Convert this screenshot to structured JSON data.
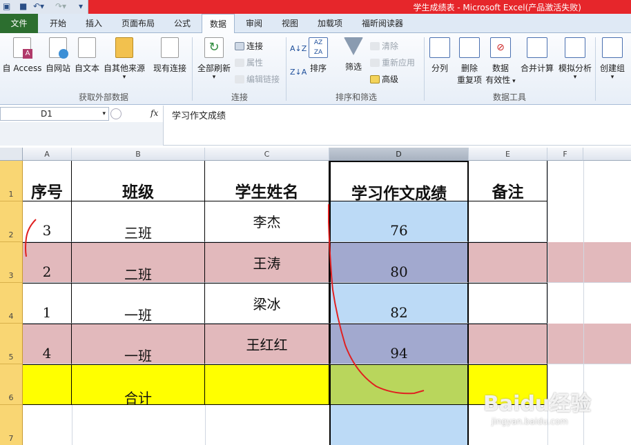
{
  "window": {
    "title": "学生成绩表 - Microsoft Excel(产品激活失败)"
  },
  "tabs": [
    "文件",
    "开始",
    "插入",
    "页面布局",
    "公式",
    "数据",
    "审阅",
    "视图",
    "加载项",
    "福昕阅读器"
  ],
  "active_tab": "数据",
  "ribbon": {
    "get_external": {
      "access": "自 Access",
      "web": "自网站",
      "text": "自文本",
      "other": "自其他来源",
      "existing": "现有连接",
      "group": "获取外部数据"
    },
    "connections": {
      "refresh": "全部刷新",
      "connect": "连接",
      "props": "属性",
      "edit_links": "编辑链接",
      "group": "连接"
    },
    "sort_filter": {
      "sort": "排序",
      "filter": "筛选",
      "clear": "清除",
      "reapply": "重新应用",
      "advanced": "高级",
      "group": "排序和筛选"
    },
    "data_tools": {
      "split": "分列",
      "remove_dup_1": "删除",
      "remove_dup_2": "重复项",
      "validation_1": "数据",
      "validation_2": "有效性",
      "consolidate": "合并计算",
      "whatif": "模拟分析",
      "group": "数据工具"
    },
    "outline": {
      "create_group": "创建组"
    }
  },
  "formula_bar": {
    "name_box": "D1",
    "fx": "fx",
    "content": "学习作文成绩"
  },
  "columns": [
    "A",
    "B",
    "C",
    "D",
    "E",
    "F"
  ],
  "rows": [
    "1",
    "2",
    "3",
    "4",
    "5",
    "6",
    "7"
  ],
  "table": {
    "headers": [
      "序号",
      "班级",
      "学生姓名",
      "学习作文成绩",
      "备注"
    ],
    "rows": [
      [
        "3",
        "三班",
        "李杰",
        "76",
        ""
      ],
      [
        "2",
        "二班",
        "王涛",
        "80",
        ""
      ],
      [
        "1",
        "一班",
        "梁冰",
        "82",
        ""
      ],
      [
        "4",
        "一班",
        "王红红",
        "94",
        ""
      ],
      [
        "",
        "合计",
        "",
        "",
        ""
      ]
    ]
  },
  "colors": {
    "pink": "#e2b9bc",
    "blue": "#bcdaf6",
    "purple": "#a2a9cf",
    "yellow": "#ffff00",
    "green": "#b9d65c",
    "annotation": "#e02020"
  },
  "watermark": {
    "main": "Baidu经验",
    "sub": "jingyan.baidu.com"
  }
}
